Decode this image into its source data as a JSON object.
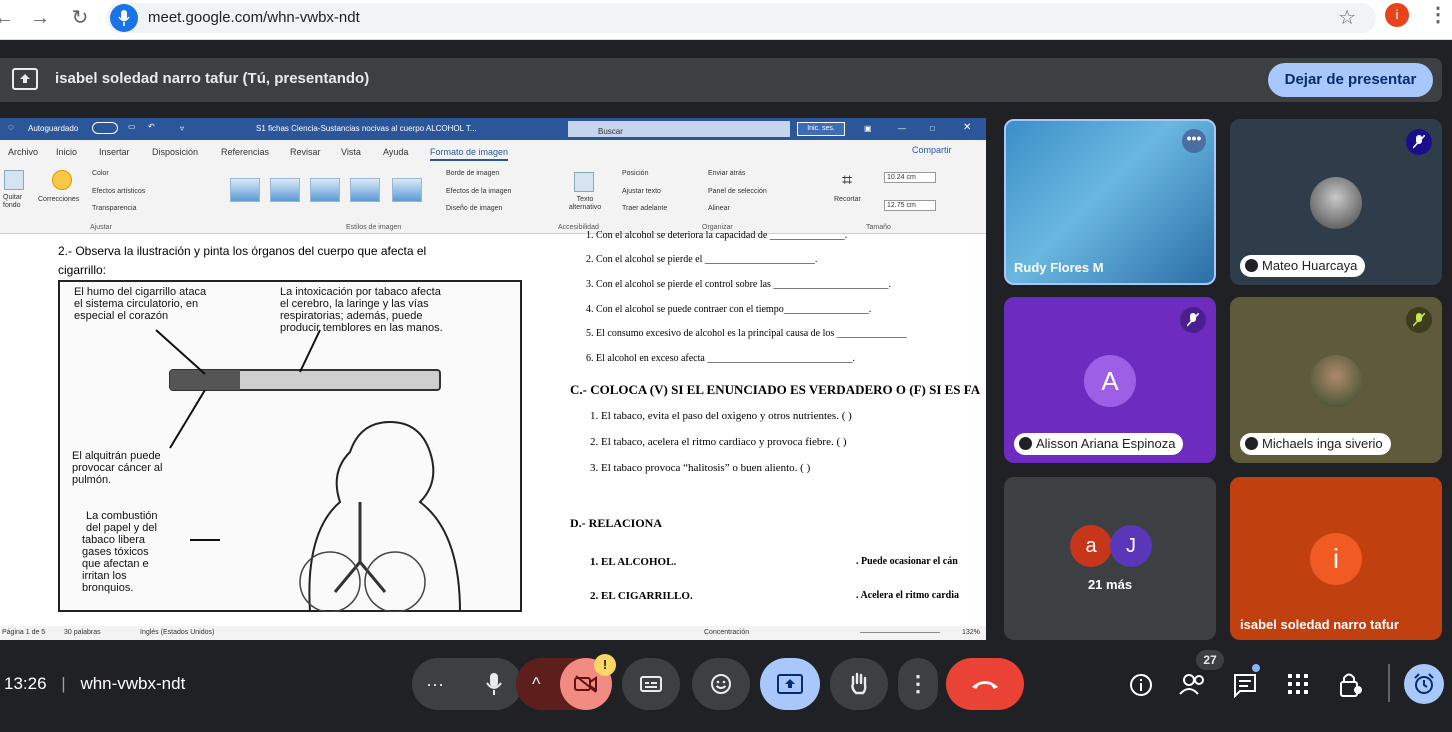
{
  "browser": {
    "url": "meet.google.com/whn-vwbx-ndt",
    "profile_initial": "i"
  },
  "presenting": {
    "text": "isabel soledad narro tafur (Tú, presentando)",
    "stop_button": "Dejar de presentar"
  },
  "word": {
    "autosave": "Autoguardado",
    "doc_title": "S1 fichas Ciencia-Sustancias nocivas al cuerpo ALCOHOL T...",
    "search_placeholder": "Buscar",
    "signin": "Inic. ses.",
    "menu": [
      "Archivo",
      "Inicio",
      "Insertar",
      "Disposición",
      "Referencias",
      "Revisar",
      "Vista",
      "Ayuda",
      "Formato de imagen"
    ],
    "share": "Compartir",
    "ribbon": {
      "quitar_fondo": "Quitar fondo",
      "correcciones": "Correcciones",
      "color": "Color",
      "efectos": "Efectos artísticos",
      "transparencia": "Transparencia",
      "group_ajustar": "Ajustar",
      "group_estilos": "Estilos de imagen",
      "borde": "Borde de imagen",
      "efectos_imagen": "Efectos de la imagen",
      "diseno": "Diseño de imagen",
      "texto_alt": "Texto alternativo",
      "group_accesibilidad": "Accesibilidad",
      "posicion": "Posición",
      "ajustar_texto": "Ajustar texto",
      "traer": "Traer adelante",
      "enviar": "Enviar atrás",
      "panel": "Panel de selección",
      "alinear": "Alinear",
      "group_organizar": "Organizar",
      "recortar": "Recortar",
      "height": "10.24 cm",
      "width": "12.75 cm",
      "group_tamano": "Tamaño"
    },
    "status": {
      "page": "Página 1 de 5",
      "words": "30 palabras",
      "lang": "Inglés (Estados Unidos)",
      "focus": "Concentración",
      "zoom": "132%"
    },
    "doc": {
      "q2_line1": "2.- Observa la ilustración y pinta los órganos del cuerpo que afecta el",
      "q2_line2": "cigarrillo:",
      "ill_1a": "El humo del cigarrillo ataca",
      "ill_1b": "el sistema circulatorio, en",
      "ill_1c": "especial el corazón",
      "ill_2a": "La intoxicación por tabaco afecta",
      "ill_2b": "el cerebro, la laringe y las vías",
      "ill_2c": "respiratorias; además, puede",
      "ill_2d": "producir temblores en las manos.",
      "ill_3a": "El alquitrán puede",
      "ill_3b": "provocar cáncer al",
      "ill_3c": "pulmón.",
      "ill_4a": "La combustión",
      "ill_4b": "del papel y del",
      "ill_4c": "tabaco libera",
      "ill_4d": "gases tóxicos",
      "ill_4e": "que afectan e",
      "ill_4f": "irritan los",
      "ill_4g": "bronquios.",
      "r_top": "1.  Con el alcohol se deteriora la capacidad de _______________.",
      "r2": "2.   Con el alcohol se pierde el ______________________.",
      "r3": "3.   Con el alcohol se pierde el control sobre las _______________________.",
      "r4": "4.   Con el alcohol se puede contraer con el tiempo_________________.",
      "r5": "5.   El consumo excesivo de alcohol es la principal causa de los ______________",
      "r6": "6.   El alcohol en exceso afecta _____________________________.",
      "c_title": "C.-  COLOCA  (V) SI EL ENUNCIADO ES VERDADERO  O (F) SI ES FA",
      "c1": "1.   El tabaco, evita el paso del oxigeno y otros nutrientes.    (   )",
      "c2": "2.   El tabaco, acelera el ritmo cardiaco y provoca fiebre.     (   )",
      "c3": "3.   El tabaco  provoca “halitosis” o buen aliento.          (   )",
      "d_title": "D.-  RELACIONA",
      "d1": "1.    EL ALCOHOL.",
      "d1r": ". Puede ocasionar el cán",
      "d2": "2.    EL CIGARRILLO.",
      "d2r": ". Acelera el ritmo cardia"
    }
  },
  "participants": [
    {
      "name": "Rudy Flores M"
    },
    {
      "name": "Mateo Huarcaya"
    },
    {
      "name": "Alisson Ariana Espinoza",
      "initial": "A"
    },
    {
      "name": "Michaels inga siverio"
    },
    {
      "more": "21 más",
      "initials": [
        "a",
        "J"
      ]
    },
    {
      "name": "isabel soledad narro tafur",
      "initial": "i"
    }
  ],
  "bottom": {
    "time": "13:26",
    "meeting_code": "whn-vwbx-ndt",
    "people_count": "27",
    "alert": "!"
  },
  "colors": {
    "accent_blue": "#a8c7fa",
    "end_call": "#ea4335",
    "word_blue": "#2b579a",
    "tile_purple": "#6d2bbf",
    "tile_orange": "#c1400f"
  }
}
